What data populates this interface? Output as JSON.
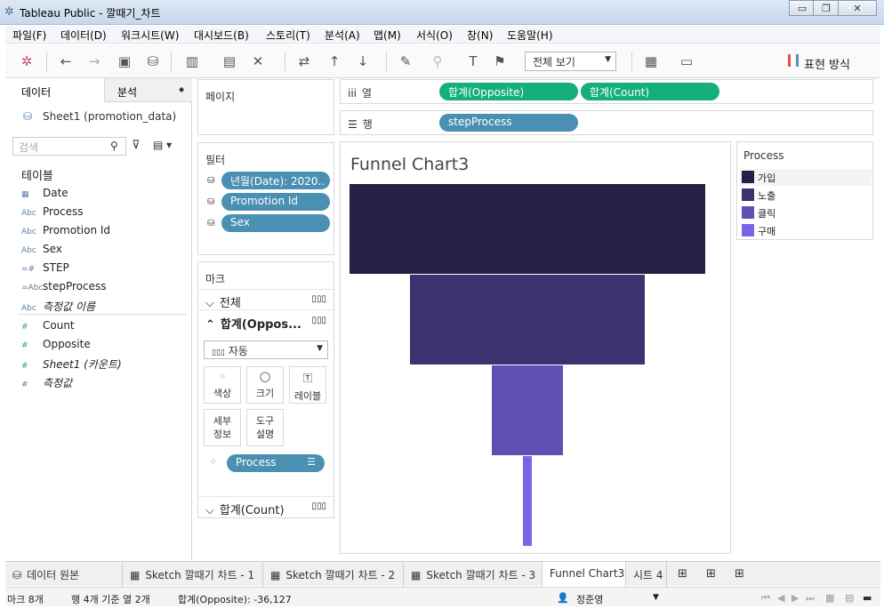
{
  "app": {
    "title": "Tableau Public - 깔때기_차트"
  },
  "menu": [
    "파일(F)",
    "데이터(D)",
    "워크시트(W)",
    "대시보드(B)",
    "스토리(T)",
    "분석(A)",
    "맵(M)",
    "서식(O)",
    "창(N)",
    "도움말(H)"
  ],
  "toolbar": {
    "fit": "전체 보기",
    "show_me": "표현 방식"
  },
  "left": {
    "tab_data": "데이터",
    "tab_analysis": "분석",
    "datasource": "Sheet1 (promotion_data)",
    "search_placeholder": "검색",
    "tables_header": "테이블",
    "dimensions": [
      {
        "icon": "date-icon",
        "type": "📅",
        "name": "Date"
      },
      {
        "icon": "abc-icon",
        "type": "Abc",
        "name": "Process"
      },
      {
        "icon": "abc-icon",
        "type": "Abc",
        "name": "Promotion Id"
      },
      {
        "icon": "abc-icon",
        "type": "Abc",
        "name": "Sex"
      },
      {
        "icon": "number-icon",
        "type": "=#",
        "name": "STEP"
      },
      {
        "icon": "abc-icon",
        "type": "=Abc",
        "name": "stepProcess"
      },
      {
        "icon": "abc-icon",
        "type": "Abc",
        "name": "측정값 이름"
      }
    ],
    "measures": [
      {
        "icon": "number-icon",
        "type": "#",
        "name": "Count"
      },
      {
        "icon": "number-icon",
        "type": "#",
        "name": "Opposite"
      },
      {
        "icon": "number-icon",
        "type": "#",
        "name": "Sheet1 (카운트)"
      },
      {
        "icon": "number-icon",
        "type": "#",
        "name": "측정값"
      }
    ]
  },
  "pages": {
    "title": "페이지"
  },
  "filters": {
    "title": "필터",
    "items": [
      "년월(Date): 2020..",
      "Promotion Id",
      "Sex"
    ]
  },
  "marks": {
    "title": "마크",
    "all": "전체",
    "sum_opposite": "합계(Oppos...",
    "type": "자동",
    "buttons": [
      "색상",
      "크기",
      "레이블",
      "세부\n정보",
      "도구\n설명"
    ],
    "process_pill": "Process",
    "sum_count": "합계(Count)"
  },
  "shelves": {
    "columns_label": "열",
    "rows_label": "행",
    "columns": [
      "합계(Opposite)",
      "합계(Count)"
    ],
    "rows": [
      "stepProcess"
    ]
  },
  "view": {
    "title": "Funnel Chart3"
  },
  "chart_data": {
    "type": "bar",
    "title": "Funnel Chart3",
    "categories": [
      "가입",
      "노출",
      "클릭",
      "구매"
    ],
    "series": [
      {
        "name": "합계(Count)",
        "values": [
          100,
          66,
          20,
          2.5
        ]
      }
    ],
    "xlabel": "",
    "ylabel": "",
    "colors": [
      "#252046",
      "#3b3270",
      "#6150b4",
      "#7b65e6"
    ],
    "legend": "right"
  },
  "legend": {
    "title": "Process",
    "items": [
      {
        "label": "가입",
        "color": "#252046"
      },
      {
        "label": "노출",
        "color": "#3b3270"
      },
      {
        "label": "클릭",
        "color": "#6150b4"
      },
      {
        "label": "구매",
        "color": "#7b65e6"
      }
    ]
  },
  "sheet_tabs": [
    "데이터 원본",
    "Sketch 깔때기 차트 - 1",
    "Sketch 깔때기 차트 - 2",
    "Sketch 깔때기 차트 - 3",
    "Funnel Chart3",
    "시트 4"
  ],
  "status": {
    "marks": "마크 8개",
    "rows_cols": "행 4개 기준 열 2개",
    "sum": "합계(Opposite): -36,127",
    "user": "정준영"
  }
}
